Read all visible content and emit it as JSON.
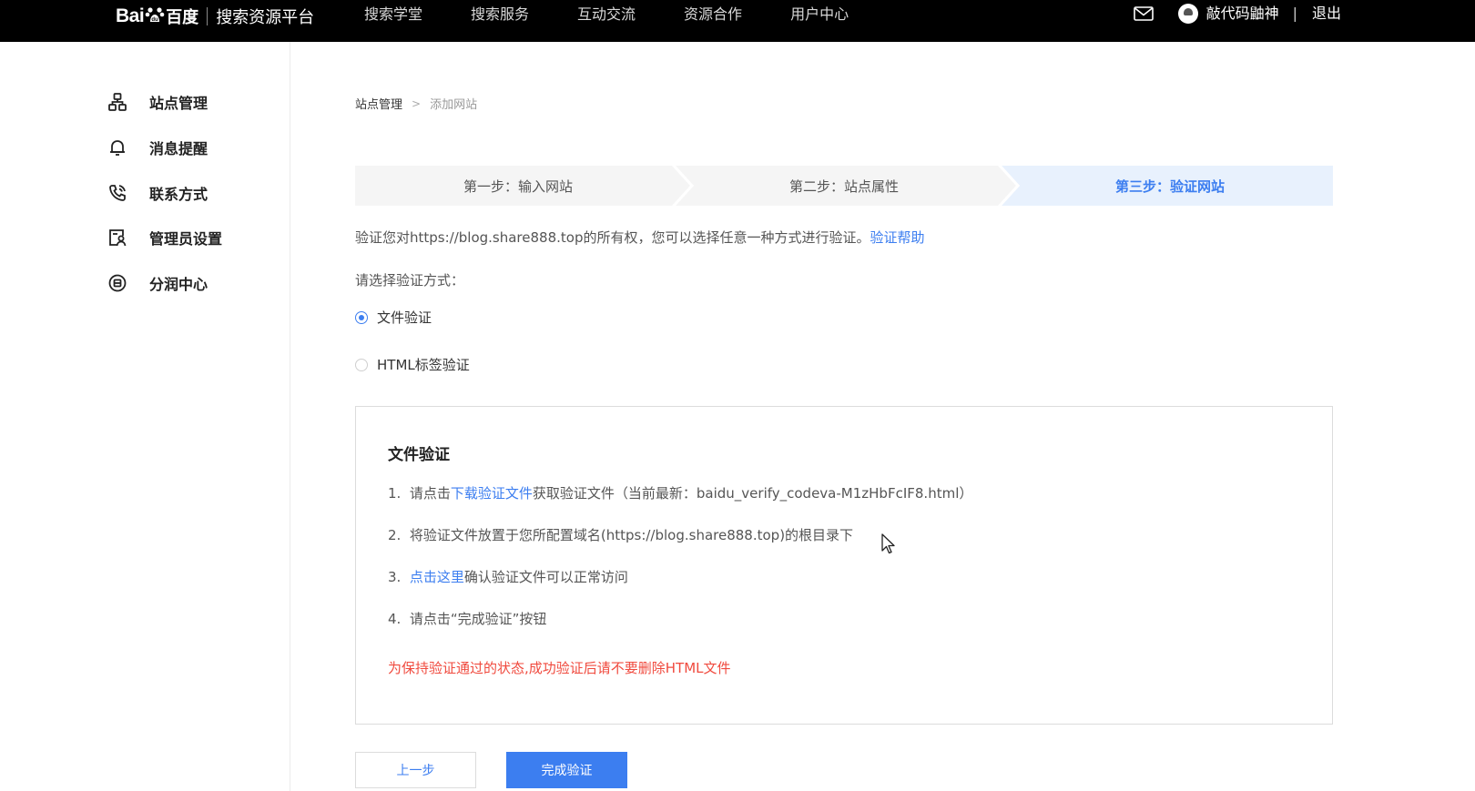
{
  "topbar": {
    "logo_text": "Bai",
    "logo_du": "百度",
    "platform": "搜索资源平台",
    "nav": [
      "搜索学堂",
      "搜索服务",
      "互动交流",
      "资源合作",
      "用户中心"
    ],
    "username": "敲代码鼬神",
    "separator": "|",
    "logout": "退出"
  },
  "sidebar": {
    "items": [
      {
        "label": "站点管理",
        "icon": "sitemap-icon"
      },
      {
        "label": "消息提醒",
        "icon": "bell-icon"
      },
      {
        "label": "联系方式",
        "icon": "phone-icon"
      },
      {
        "label": "管理员设置",
        "icon": "admin-settings-icon"
      },
      {
        "label": "分润中心",
        "icon": "revenue-share-icon"
      }
    ]
  },
  "breadcrumb": {
    "root": "站点管理",
    "separator": ">",
    "current": "添加网站"
  },
  "steps": [
    {
      "label": "第一步：输入网站",
      "active": false
    },
    {
      "label": "第二步：站点属性",
      "active": false
    },
    {
      "label": "第三步：验证网站",
      "active": true
    }
  ],
  "intro": {
    "text": "验证您对https://blog.share888.top的所有权，您可以选择任意一种方式进行验证。",
    "help_link": "验证帮助"
  },
  "choose_label": "请选择验证方式：",
  "methods": [
    {
      "label": "文件验证",
      "checked": true
    },
    {
      "label": "HTML标签验证",
      "checked": false
    }
  ],
  "panel": {
    "title": "文件验证",
    "step1_num": "1.",
    "step1_prefix": "请点击",
    "step1_link": "下载验证文件",
    "step1_suffix": "获取验证文件（当前最新：baidu_verify_codeva-M1zHbFcIF8.html）",
    "step2_num": "2.",
    "step2_text": "将验证文件放置于您所配置域名(https://blog.share888.top)的根目录下",
    "step3_num": "3.",
    "step3_link": "点击这里",
    "step3_suffix": "确认验证文件可以正常访问",
    "step4_num": "4.",
    "step4_text": "请点击“完成验证”按钮",
    "warning": "为保持验证通过的状态,成功验证后请不要删除HTML文件"
  },
  "buttons": {
    "prev": "上一步",
    "finish": "完成验证"
  },
  "colors": {
    "accent": "#3c7ef0",
    "warning": "#f04a3e",
    "step_active_bg": "#e8f1fd",
    "step_bg": "#f5f5f5",
    "topbar_bg": "#000000"
  }
}
